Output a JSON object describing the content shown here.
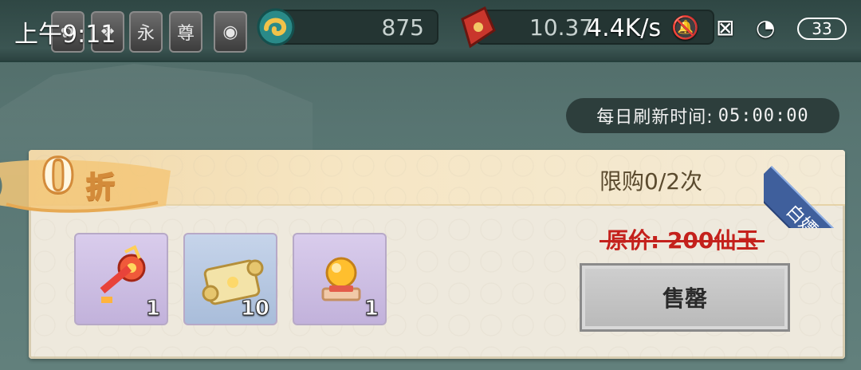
{
  "status_bar": {
    "time": "上午9:11",
    "network_speed": "4.4K/s",
    "battery": "33"
  },
  "top_bar": {
    "badges": [
      "永",
      "尊"
    ],
    "resource_1": "875",
    "resource_2": "10.37"
  },
  "refresh": {
    "label": "每日刷新时间:",
    "time": "05:00:00"
  },
  "offer": {
    "discount_number": "0",
    "discount_unit": "折",
    "limit": "限购0/2次",
    "tag": "白嫖",
    "original_price": "原价: 200仙玉",
    "button": "售罄",
    "items": [
      {
        "icon": "key-icon",
        "count": "1"
      },
      {
        "icon": "scroll-icon",
        "count": "10"
      },
      {
        "icon": "orb-icon",
        "count": "1"
      }
    ]
  },
  "colors": {
    "price_red": "#c4211c",
    "tag_blue": "#3f5f9c",
    "discount_orange": "#d38b3a"
  }
}
